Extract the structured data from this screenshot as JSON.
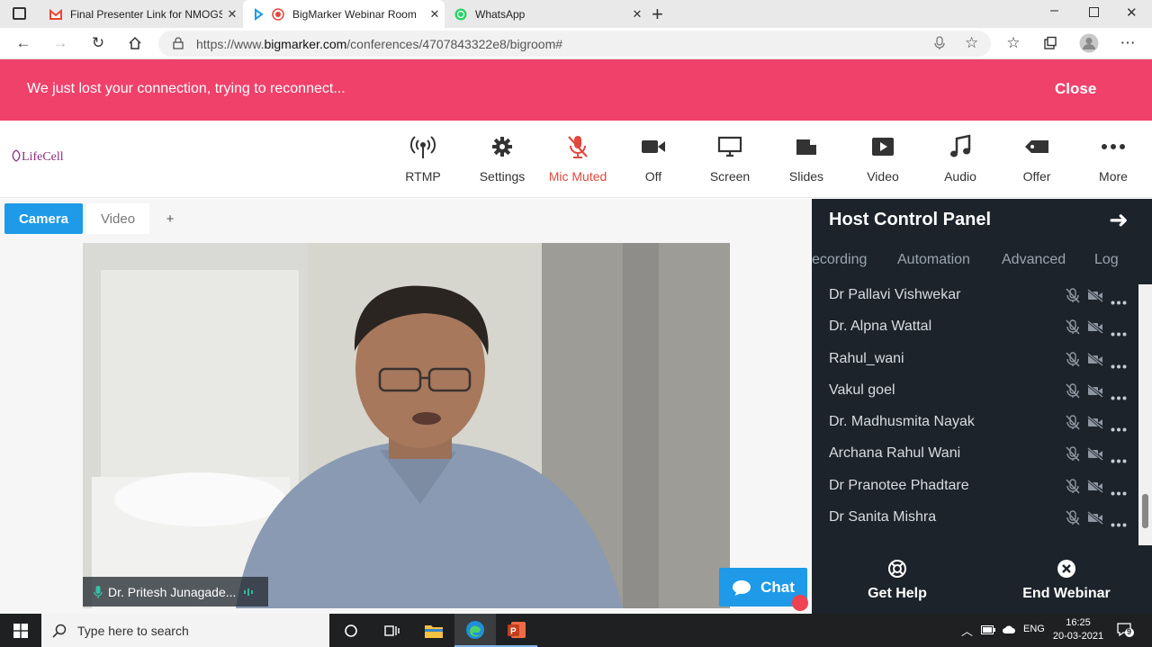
{
  "browser": {
    "tabs": [
      {
        "title": "Final Presenter Link for NMOGS",
        "icon": "gmail-icon"
      },
      {
        "title": "BigMarker Webinar Room",
        "icon": "bigmarker-icon",
        "active": true
      },
      {
        "title": "WhatsApp",
        "icon": "whatsapp-icon"
      }
    ],
    "url_prefix": "https://www.",
    "url_domain": "bigmarker.com",
    "url_path": "/conferences/4707843322e8/bigroom#"
  },
  "banner": {
    "message": "We just lost your connection, trying to reconnect...",
    "close_label": "Close",
    "color": "#f0416b"
  },
  "logo": "LifeCell",
  "toolbar": [
    {
      "label": "RTMP",
      "icon": "broadcast-icon"
    },
    {
      "label": "Settings",
      "icon": "gear-icon"
    },
    {
      "label": "Mic Muted",
      "icon": "mic-muted-icon",
      "color": "#e2483f"
    },
    {
      "label": "Off",
      "icon": "camera-icon"
    },
    {
      "label": "Screen",
      "icon": "monitor-icon"
    },
    {
      "label": "Slides",
      "icon": "slides-icon"
    },
    {
      "label": "Video",
      "icon": "play-icon"
    },
    {
      "label": "Audio",
      "icon": "music-icon"
    },
    {
      "label": "Offer",
      "icon": "tag-icon"
    },
    {
      "label": "More",
      "icon": "more-icon"
    }
  ],
  "stage": {
    "tabs": {
      "camera": "Camera",
      "video": "Video",
      "add": "+"
    },
    "presenter_name": "Dr. Pritesh Junagade...",
    "chat_label": "Chat"
  },
  "panel": {
    "title": "Host Control Panel",
    "tabs": [
      "ecording",
      "Automation",
      "Advanced",
      "Log"
    ],
    "attendees": [
      "Dr Pallavi Vishwekar",
      "Dr. Alpna Wattal",
      "Rahul_wani",
      "Vakul goel",
      "Dr. Madhusmita Nayak",
      "Archana Rahul Wani",
      "Dr Pranotee Phadtare",
      "Dr Sanita Mishra"
    ],
    "get_help": "Get Help",
    "end_webinar": "End Webinar"
  },
  "taskbar": {
    "search_placeholder": "Type here to search",
    "language": "ENG",
    "time": "16:25",
    "date": "20-03-2021",
    "notifications": "9"
  }
}
